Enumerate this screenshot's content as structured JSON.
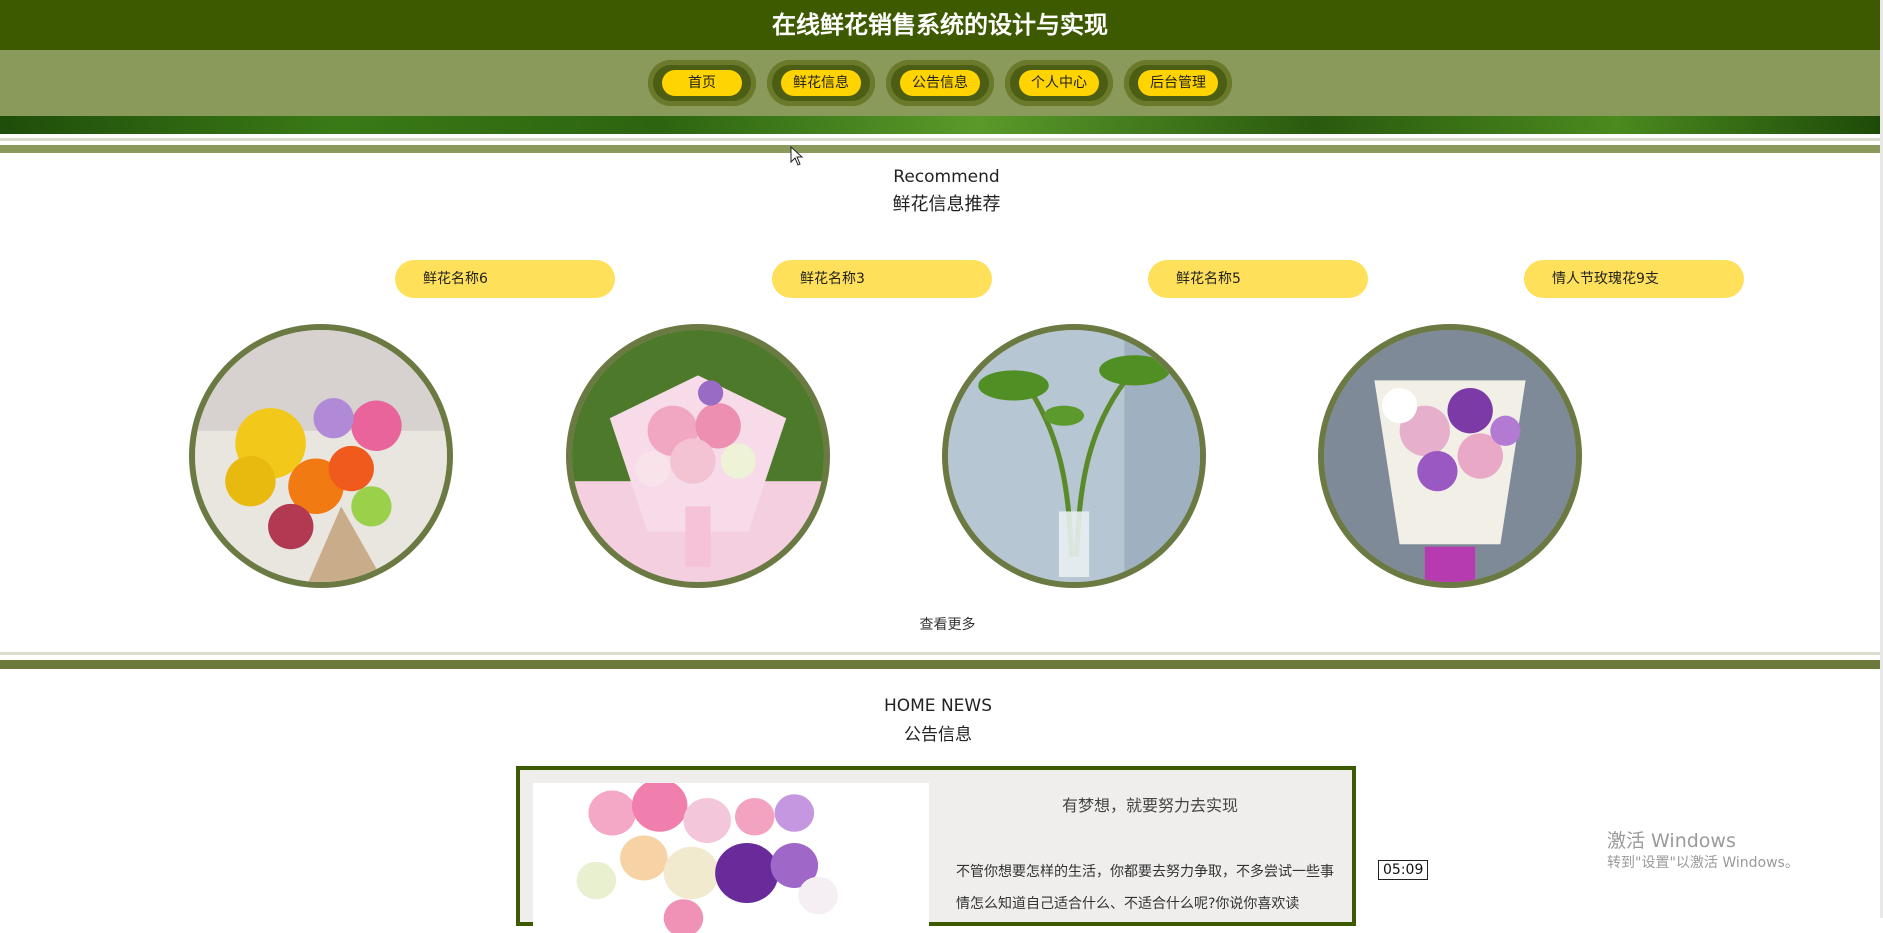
{
  "header": {
    "title": "在线鲜花销售系统的设计与实现"
  },
  "nav": {
    "items": [
      {
        "label": "首页"
      },
      {
        "label": "鲜花信息"
      },
      {
        "label": "公告信息"
      },
      {
        "label": "个人中心"
      },
      {
        "label": "后台管理"
      }
    ]
  },
  "recommend": {
    "title_en": "Recommend",
    "title_cn": "鲜花信息推荐",
    "items": [
      {
        "name": "鲜花名称6"
      },
      {
        "name": "鲜花名称3"
      },
      {
        "name": "鲜花名称5"
      },
      {
        "name": "情人节玫瑰花9支"
      }
    ],
    "more_label": "查看更多"
  },
  "news": {
    "title_en": "HOME NEWS",
    "title_cn": "公告信息",
    "item": {
      "title": "有梦想，就要努力去实现",
      "body": "不管你想要怎样的生活，你都要去努力争取，不多尝试一些事情怎么知道自己适合什么、不适合什么呢?你说你喜欢读"
    }
  },
  "system": {
    "watermark_line1": "激活 Windows",
    "watermark_line2": "转到\"设置\"以激活 Windows。",
    "clock": "05:09"
  },
  "colors": {
    "header_bg": "#3d5a00",
    "nav_bg": "#8a9a5b",
    "nav_pill": "#ffd400",
    "name_pill": "#ffe05a",
    "circle_ring": "#6b7a43"
  }
}
